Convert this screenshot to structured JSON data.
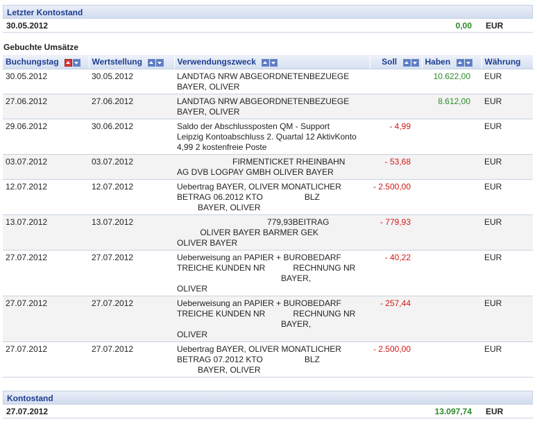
{
  "last_balance": {
    "title": "Letzter Kontostand",
    "date": "30.05.2012",
    "amount": "0,00",
    "currency": "EUR"
  },
  "bookings_title": "Gebuchte Umsätze",
  "columns": {
    "booking_date": "Buchungstag",
    "value_date": "Wertstellung",
    "purpose": "Verwendungszweck",
    "debit": "Soll",
    "credit": "Haben",
    "currency": "Währung"
  },
  "colors": {
    "header_text": "#1c3d8f",
    "negative": "#d01818",
    "positive": "#2a8a2a"
  },
  "rows": [
    {
      "booking_date": "30.05.2012",
      "value_date": "30.05.2012",
      "purpose": "LANDTAG NRW ABGEORDNETENBEZUEGE\nBAYER, OLIVER",
      "debit": "",
      "credit": "10.622,00",
      "currency": "EUR"
    },
    {
      "booking_date": "27.06.2012",
      "value_date": "27.06.2012",
      "purpose": "LANDTAG NRW ABGEORDNETENBEZUEGE\nBAYER, OLIVER",
      "debit": "",
      "credit": "8.612,00",
      "currency": "EUR"
    },
    {
      "booking_date": "29.06.2012",
      "value_date": "30.06.2012",
      "purpose": "Saldo der Abschlussposten QM - Support\nLeipzig Kontoabschluss 2. Quartal 12 AktivKonto\n4,99 2 kostenfreie Poste",
      "debit": "- 4,99",
      "credit": "",
      "currency": "EUR"
    },
    {
      "booking_date": "03.07.2012",
      "value_date": "03.07.2012",
      "purpose": "                        FIRMENTICKET RHEINBAHN\nAG DVB LOGPAY GMBH OLIVER BAYER",
      "debit": "- 53,68",
      "credit": "",
      "currency": "EUR"
    },
    {
      "booking_date": "12.07.2012",
      "value_date": "12.07.2012",
      "purpose": "Uebertrag BAYER, OLIVER MONATLICHER\nBETRAG 06.2012 KTO                  BLZ\n         BAYER, OLIVER",
      "debit": "- 2.500,00",
      "credit": "",
      "currency": "EUR"
    },
    {
      "booking_date": "13.07.2012",
      "value_date": "13.07.2012",
      "purpose": "                                       779,93BEITRAG\n          OLIVER BAYER BARMER GEK\nOLIVER BAYER",
      "debit": "- 779,93",
      "credit": "",
      "currency": "EUR"
    },
    {
      "booking_date": "27.07.2012",
      "value_date": "27.07.2012",
      "purpose": "Ueberweisung an PAPIER + BUROBEDARF\nTREICHE KUNDEN NR            RECHNUNG NR\n                                             BAYER,\nOLIVER",
      "debit": "- 40,22",
      "credit": "",
      "currency": "EUR"
    },
    {
      "booking_date": "27.07.2012",
      "value_date": "27.07.2012",
      "purpose": "Ueberweisung an PAPIER + BUROBEDARF\nTREICHE KUNDEN NR            RECHNUNG NR\n                                             BAYER,\nOLIVER",
      "debit": "- 257,44",
      "credit": "",
      "currency": "EUR"
    },
    {
      "booking_date": "27.07.2012",
      "value_date": "27.07.2012",
      "purpose": "Uebertrag BAYER, OLIVER MONATLICHER\nBETRAG 07.2012 KTO                  BLZ\n         BAYER, OLIVER",
      "debit": "- 2.500,00",
      "credit": "",
      "currency": "EUR"
    }
  ],
  "current_balance": {
    "title": "Kontostand",
    "date": "27.07.2012",
    "amount": "13.097,74",
    "currency": "EUR"
  }
}
